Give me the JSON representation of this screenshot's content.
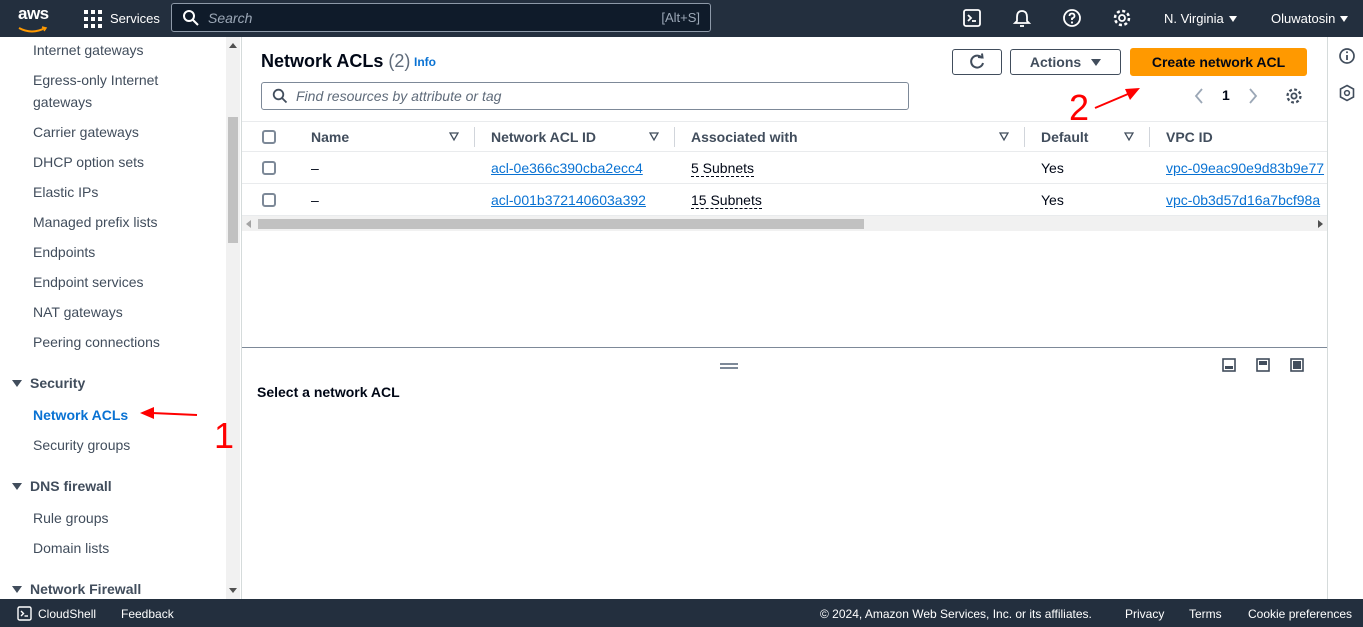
{
  "topnav": {
    "logo_text": "aws",
    "services_label": "Services",
    "search_placeholder": "Search",
    "search_shortcut": "[Alt+S]",
    "region_label": "N. Virginia",
    "user_label": "Oluwatosin"
  },
  "sidebar": {
    "items_top": [
      "Internet gateways",
      "Egress-only Internet",
      "gateways",
      "Carrier gateways",
      "DHCP option sets",
      "Elastic IPs",
      "Managed prefix lists",
      "Endpoints",
      "Endpoint services",
      "NAT gateways",
      "Peering connections"
    ],
    "sections": {
      "security": {
        "label": "Security",
        "items": [
          "Network ACLs",
          "Security groups"
        ]
      },
      "dns_firewall": {
        "label": "DNS firewall",
        "items": [
          "Rule groups",
          "Domain lists"
        ]
      },
      "network_firewall": {
        "label": "Network Firewall"
      }
    }
  },
  "main": {
    "title": "Network ACLs",
    "count": "(2)",
    "info_label": "Info",
    "actions_label": "Actions",
    "create_label": "Create network ACL",
    "filter_placeholder": "Find resources by attribute or tag",
    "page_number": "1",
    "table": {
      "columns": [
        "Name",
        "Network ACL ID",
        "Associated with",
        "Default",
        "VPC ID"
      ],
      "rows": [
        {
          "name": "–",
          "acl_id": "acl-0e366c390cba2ecc4",
          "associated": "5 Subnets",
          "default": "Yes",
          "vpc_id": "vpc-09eac90e9d83b9e77"
        },
        {
          "name": "–",
          "acl_id": "acl-001b372140603a392",
          "associated": "15 Subnets",
          "default": "Yes",
          "vpc_id": "vpc-0b3d57d16a7bcf98a"
        }
      ]
    },
    "split_title": "Select a network ACL"
  },
  "annotations": {
    "one": "1",
    "two": "2",
    "color": "#ff0000"
  },
  "footer": {
    "cloudshell": "CloudShell",
    "feedback": "Feedback",
    "copyright": "© 2024, Amazon Web Services, Inc. or its affiliates.",
    "privacy": "Privacy",
    "terms": "Terms",
    "cookies": "Cookie preferences"
  },
  "colors": {
    "nav_bg": "#232f3e",
    "accent": "#ff9900",
    "link": "#0972d3"
  }
}
